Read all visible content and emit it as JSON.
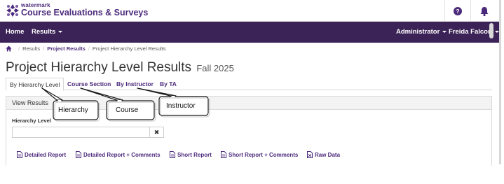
{
  "brand": {
    "company": "watermark",
    "product": "Course Evaluations & Surveys"
  },
  "topbar": {
    "icons": [
      "help-icon",
      "bell-icon"
    ]
  },
  "nav": {
    "home": "Home",
    "results": "Results",
    "administrator": "Administrator",
    "user": "Freida Falcon"
  },
  "breadcrumb": {
    "items": [
      "Results",
      "Project Results",
      "Project Hierarchy Level Results"
    ]
  },
  "page": {
    "title": "Project Hierarchy Level Results",
    "term": "Fall 2025"
  },
  "tabs": [
    {
      "label": "By Hierarchy Level",
      "active": true
    },
    {
      "label": "Course Section",
      "active": false
    },
    {
      "label": "By Instructor",
      "active": false
    },
    {
      "label": "By TA",
      "active": false
    }
  ],
  "panel": {
    "heading": "View Results",
    "field_label": "Hierarchy Level",
    "field_value": "",
    "clear_symbol": "✖"
  },
  "reports": [
    {
      "label": "Detailed Report"
    },
    {
      "label": "Detailed Report + Comments"
    },
    {
      "label": "Short Report"
    },
    {
      "label": "Short Report + Comments"
    },
    {
      "label": "Raw Data"
    }
  ],
  "callouts": [
    {
      "label": "Hierarchy"
    },
    {
      "label": "Course"
    },
    {
      "label": "Instructor"
    }
  ],
  "colors": {
    "brand_purple": "#3b2357",
    "link_purple": "#4b2a7b"
  }
}
